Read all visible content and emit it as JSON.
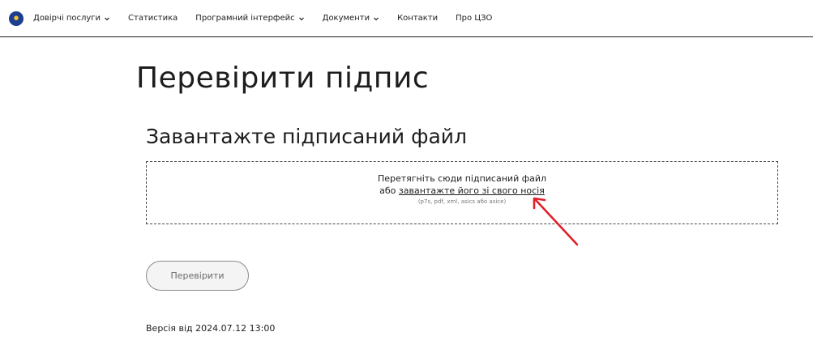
{
  "nav": {
    "items": [
      {
        "label": "Довірчі послуги",
        "dropdown": true
      },
      {
        "label": "Статистика",
        "dropdown": false
      },
      {
        "label": "Програмний інтерфейс",
        "dropdown": true
      },
      {
        "label": "Документи",
        "dropdown": true
      },
      {
        "label": "Контакти",
        "dropdown": false
      },
      {
        "label": "Про ЦЗО",
        "dropdown": false
      }
    ]
  },
  "page": {
    "title": "Перевірити підпис",
    "section_title": "Завантажте підписаний файл"
  },
  "dropzone": {
    "line1": "Перетягніть сюди підписаний файл",
    "line2_prefix": "або ",
    "link_text": "завантажте його зі свого носія",
    "hint": "(p7s, pdf, xml, asics або asice)"
  },
  "actions": {
    "check_label": "Перевірити"
  },
  "footer": {
    "version": "Версія від 2024.07.12 13:00"
  },
  "colors": {
    "text": "#1d1d1f",
    "annotation_arrow": "#e0202a",
    "button_border": "#8a8a8a"
  },
  "icons": {
    "logo": "coat-of-arms-icon",
    "dropdown": "chevron-down-icon",
    "annotation": "red-arrow-icon"
  }
}
